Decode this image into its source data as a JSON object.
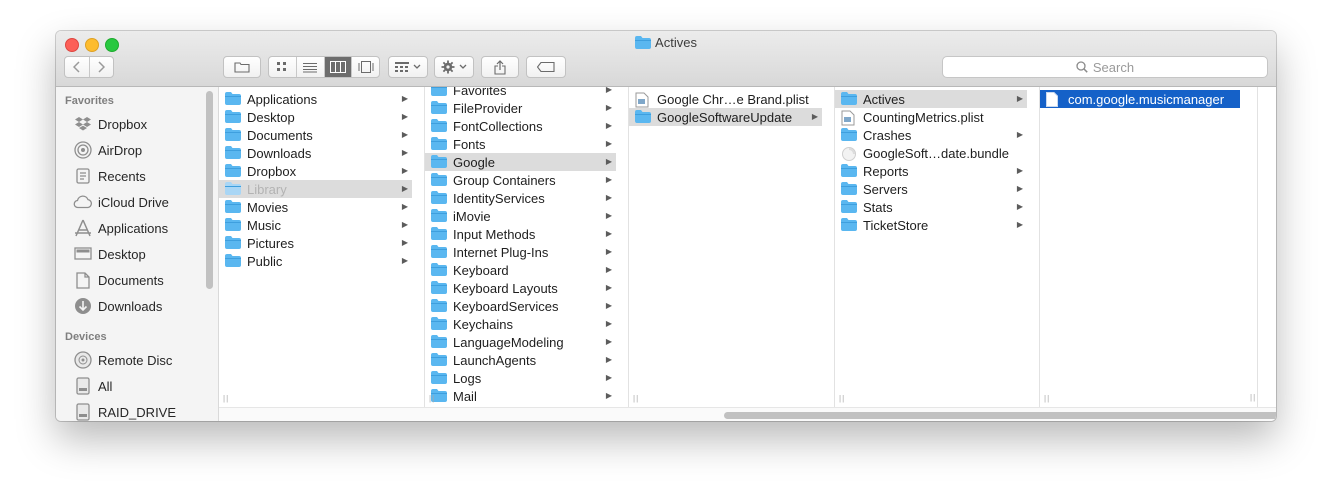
{
  "window": {
    "title": "Actives"
  },
  "toolbar": {
    "search_placeholder": "Search"
  },
  "sidebar": {
    "favorites_header": "Favorites",
    "favorites": [
      {
        "label": "Dropbox",
        "icon": "dropbox-icon"
      },
      {
        "label": "AirDrop",
        "icon": "airdrop-icon"
      },
      {
        "label": "Recents",
        "icon": "recents-icon"
      },
      {
        "label": "iCloud Drive",
        "icon": "cloud-icon"
      },
      {
        "label": "Applications",
        "icon": "applications-icon"
      },
      {
        "label": "Desktop",
        "icon": "desktop-icon"
      },
      {
        "label": "Documents",
        "icon": "documents-icon"
      },
      {
        "label": "Downloads",
        "icon": "downloads-icon"
      }
    ],
    "devices_header": "Devices",
    "devices": [
      {
        "label": "Remote Disc",
        "icon": "disc-icon"
      },
      {
        "label": "All",
        "icon": "drive-icon"
      },
      {
        "label": "RAID_DRIVE",
        "icon": "drive-icon"
      }
    ]
  },
  "columns": [
    {
      "items": [
        {
          "label": "Applications",
          "arrow": true
        },
        {
          "label": "Desktop",
          "arrow": true
        },
        {
          "label": "Documents",
          "arrow": true
        },
        {
          "label": "Downloads",
          "arrow": true
        },
        {
          "label": "Dropbox",
          "arrow": true
        },
        {
          "label": "Library",
          "arrow": true,
          "state": "selected-gray",
          "dim": true
        },
        {
          "label": "Movies",
          "arrow": true
        },
        {
          "label": "Music",
          "arrow": true
        },
        {
          "label": "Pictures",
          "arrow": true
        },
        {
          "label": "Public",
          "arrow": true
        }
      ]
    },
    {
      "items": [
        {
          "label": "Favorites",
          "arrow": true
        },
        {
          "label": "FileProvider",
          "arrow": true
        },
        {
          "label": "FontCollections",
          "arrow": true
        },
        {
          "label": "Fonts",
          "arrow": true
        },
        {
          "label": "Google",
          "arrow": true,
          "state": "selected-gray"
        },
        {
          "label": "Group Containers",
          "arrow": true
        },
        {
          "label": "IdentityServices",
          "arrow": true
        },
        {
          "label": "iMovie",
          "arrow": true
        },
        {
          "label": "Input Methods",
          "arrow": true
        },
        {
          "label": "Internet Plug-Ins",
          "arrow": true
        },
        {
          "label": "Keyboard",
          "arrow": true
        },
        {
          "label": "Keyboard Layouts",
          "arrow": true
        },
        {
          "label": "KeyboardServices",
          "arrow": true
        },
        {
          "label": "Keychains",
          "arrow": true
        },
        {
          "label": "LanguageModeling",
          "arrow": true
        },
        {
          "label": "LaunchAgents",
          "arrow": true
        },
        {
          "label": "Logs",
          "arrow": true
        },
        {
          "label": "Mail",
          "arrow": true
        }
      ]
    },
    {
      "items": [
        {
          "label": "Google Chr…e Brand.plist",
          "arrow": false,
          "kind": "plist"
        },
        {
          "label": "GoogleSoftwareUpdate",
          "arrow": true,
          "state": "selected-gray"
        }
      ]
    },
    {
      "items": [
        {
          "label": "Actives",
          "arrow": true,
          "state": "selected-gray"
        },
        {
          "label": "CountingMetrics.plist",
          "arrow": false,
          "kind": "plist"
        },
        {
          "label": "Crashes",
          "arrow": true
        },
        {
          "label": "GoogleSoft…date.bundle",
          "arrow": false,
          "kind": "bundle"
        },
        {
          "label": "Reports",
          "arrow": true
        },
        {
          "label": "Servers",
          "arrow": true
        },
        {
          "label": "Stats",
          "arrow": true
        },
        {
          "label": "TicketStore",
          "arrow": true
        }
      ]
    },
    {
      "items": [
        {
          "label": "com.google.musicmanager",
          "arrow": false,
          "kind": "file",
          "state": "selected-blue"
        }
      ]
    }
  ],
  "colors": {
    "accent": "#1561c8",
    "folder": "#5ab7f0"
  }
}
